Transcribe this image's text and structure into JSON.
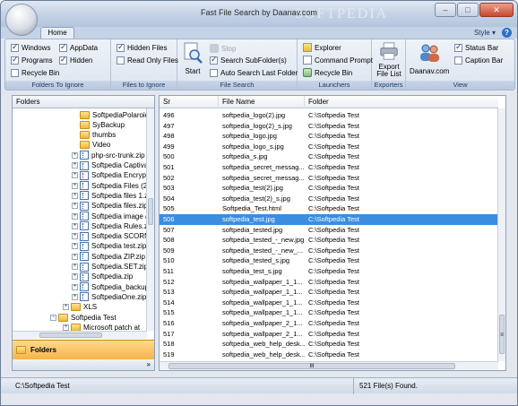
{
  "window": {
    "title": "Fast File Search by Daanav.com",
    "watermark": "SOFTPEDIA",
    "minimize": "–",
    "maximize": "□",
    "close": "✕"
  },
  "ribbon": {
    "tab": "Home",
    "style_label": "Style",
    "help_label": "?",
    "groups": {
      "ignore": {
        "label": "Folders To Ignore",
        "windows": "Windows",
        "appdata": "AppData",
        "programs": "Programs",
        "hidden": "Hidden",
        "recycle": "Recycle Bin"
      },
      "files_ignore": {
        "label": "Files to Ignore",
        "hidden_files": "Hidden Files",
        "read_only": "Read Only Files"
      },
      "search": {
        "label": "File Search",
        "start": "Start",
        "stop": "Stop",
        "subfolders": "Search SubFolder(s)",
        "auto": "Auto Search Last Folder"
      },
      "launchers": {
        "label": "Launchers",
        "explorer": "Explorer",
        "cmd": "Command Prompt",
        "recycle": "Recycle Bin"
      },
      "exporters": {
        "label": "Exporters",
        "export": "Export File List"
      },
      "daanav": {
        "label": "Daanav.com"
      },
      "view": {
        "label": "View",
        "status_bar": "Status Bar",
        "caption_bar": "Caption Bar"
      }
    }
  },
  "left_panel": {
    "header": "Folders",
    "tree": [
      {
        "label": "SoftpediaPolaroid",
        "kind": "folder",
        "level": 3,
        "expander": ""
      },
      {
        "label": "SyBackup",
        "kind": "folder",
        "level": 3,
        "expander": ""
      },
      {
        "label": "thumbs",
        "kind": "folder",
        "level": 3,
        "expander": ""
      },
      {
        "label": "Video",
        "kind": "folder",
        "level": 3,
        "expander": ""
      },
      {
        "label": "php-src-trunk.zip",
        "kind": "zip",
        "level": 3,
        "expander": "+"
      },
      {
        "label": "Softpedia Captiva",
        "kind": "zip",
        "level": 3,
        "expander": "+"
      },
      {
        "label": "Softpedia Encrypt",
        "kind": "zip",
        "level": 3,
        "expander": "+"
      },
      {
        "label": "Softpedia Files (2)",
        "kind": "zip",
        "level": 3,
        "expander": "+"
      },
      {
        "label": "Softpedia files 1.zi",
        "kind": "zip",
        "level": 3,
        "expander": "+"
      },
      {
        "label": "Softpedia files.zip",
        "kind": "zip",
        "level": 3,
        "expander": "+"
      },
      {
        "label": "Softpedia image a",
        "kind": "zip",
        "level": 3,
        "expander": "+"
      },
      {
        "label": "Softpedia Rules.zi",
        "kind": "zip",
        "level": 3,
        "expander": "+"
      },
      {
        "label": "Softpedia SCORM",
        "kind": "zip",
        "level": 3,
        "expander": "+"
      },
      {
        "label": "Softpedia test.zip",
        "kind": "zip",
        "level": 3,
        "expander": "+"
      },
      {
        "label": "Softpedia ZIP.zip",
        "kind": "zip",
        "level": 3,
        "expander": "+"
      },
      {
        "label": "Softpedia.SET.zip",
        "kind": "zip",
        "level": 3,
        "expander": "+"
      },
      {
        "label": "Softpedia.zip",
        "kind": "zip",
        "level": 3,
        "expander": "+"
      },
      {
        "label": "Softpedia_backup",
        "kind": "zip",
        "level": 3,
        "expander": "+"
      },
      {
        "label": "SoftpediaOne.zip",
        "kind": "zip",
        "level": 3,
        "expander": "+"
      },
      {
        "label": "XLS",
        "kind": "folder",
        "level": 2,
        "expander": "+"
      },
      {
        "label": "Softpedia Test",
        "kind": "folder",
        "level": 1,
        "expander": "−"
      },
      {
        "label": "Microsoft patch at",
        "kind": "folder",
        "level": 2,
        "expander": "+"
      }
    ],
    "bottom_button": "Folders",
    "footer": "»"
  },
  "list": {
    "columns": [
      "Sr",
      "File Name",
      "Folder"
    ],
    "selected_sr": "506",
    "rows": [
      {
        "sr": "496",
        "name": "softpedia_logo(2).jpg",
        "folder": "C:\\Softpedia Test"
      },
      {
        "sr": "497",
        "name": "softpedia_logo(2)_s.jpg",
        "folder": "C:\\Softpedia Test"
      },
      {
        "sr": "498",
        "name": "softpedia_logo.jpg",
        "folder": "C:\\Softpedia Test"
      },
      {
        "sr": "499",
        "name": "softpedia_logo_s.jpg",
        "folder": "C:\\Softpedia Test"
      },
      {
        "sr": "500",
        "name": "softpedia_s.jpg",
        "folder": "C:\\Softpedia Test"
      },
      {
        "sr": "501",
        "name": "softpedia_secret_messag...",
        "folder": "C:\\Softpedia Test"
      },
      {
        "sr": "502",
        "name": "softpedia_secret_messag...",
        "folder": "C:\\Softpedia Test"
      },
      {
        "sr": "503",
        "name": "softpedia_test(2).jpg",
        "folder": "C:\\Softpedia Test"
      },
      {
        "sr": "504",
        "name": "softpedia_test(2)_s.jpg",
        "folder": "C:\\Softpedia Test"
      },
      {
        "sr": "505",
        "name": "Softpedia_Test.html",
        "folder": "C:\\Softpedia Test"
      },
      {
        "sr": "506",
        "name": "softpedia_test.jpg",
        "folder": "C:\\Softpedia Test"
      },
      {
        "sr": "507",
        "name": "softpedia_tested.jpg",
        "folder": "C:\\Softpedia Test"
      },
      {
        "sr": "508",
        "name": "softpedia_tested_-_new.jpg",
        "folder": "C:\\Softpedia Test"
      },
      {
        "sr": "509",
        "name": "softpedia_tested_-_new_...",
        "folder": "C:\\Softpedia Test"
      },
      {
        "sr": "510",
        "name": "softpedia_tested_s.jpg",
        "folder": "C:\\Softpedia Test"
      },
      {
        "sr": "511",
        "name": "softpedia_test_s.jpg",
        "folder": "C:\\Softpedia Test"
      },
      {
        "sr": "512",
        "name": "softpedia_wallpaper_1_1...",
        "folder": "C:\\Softpedia Test"
      },
      {
        "sr": "513",
        "name": "softpedia_wallpaper_1_1...",
        "folder": "C:\\Softpedia Test"
      },
      {
        "sr": "514",
        "name": "softpedia_wallpaper_1_1...",
        "folder": "C:\\Softpedia Test"
      },
      {
        "sr": "515",
        "name": "softpedia_wallpaper_1_1...",
        "folder": "C:\\Softpedia Test"
      },
      {
        "sr": "516",
        "name": "softpedia_wallpaper_2_1...",
        "folder": "C:\\Softpedia Test"
      },
      {
        "sr": "517",
        "name": "softpedia_wallpaper_2_1...",
        "folder": "C:\\Softpedia Test"
      },
      {
        "sr": "518",
        "name": "softpedia_web_help_desk...",
        "folder": "C:\\Softpedia Test"
      },
      {
        "sr": "519",
        "name": "softpedia_web_help_desk...",
        "folder": "C:\\Softpedia Test"
      },
      {
        "sr": "520",
        "name": "softpedia_wp.jpg",
        "folder": "C:\\Softpedia Test"
      }
    ],
    "hscroll_grip": "III",
    "vscroll_grip": "≡"
  },
  "status": {
    "path": "C:\\Softpedia Test",
    "count": "521 File(s) Found."
  },
  "colors": {
    "selection": "#3b8de0",
    "accent": "#f6b44a"
  }
}
